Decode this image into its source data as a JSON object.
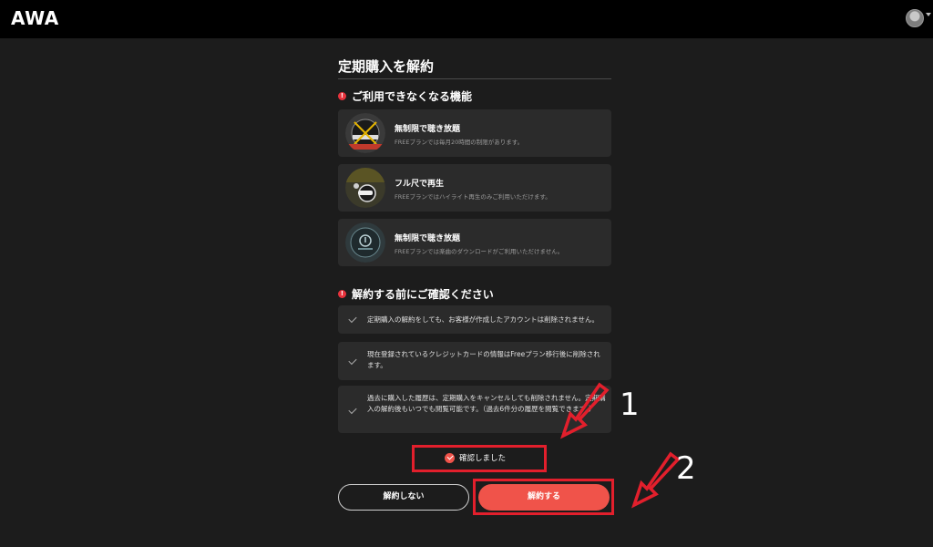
{
  "app": {
    "logo": "AWA"
  },
  "dialog": {
    "title": "定期購入を解約",
    "features_heading": "ご利用できなくなる機能",
    "features": [
      {
        "title": "無制限で聴き放題",
        "description": "FREEプランでは毎月20時間の制限があります。",
        "icon": "unlimited-listening-thumbnail"
      },
      {
        "title": "フル尺で再生",
        "description": "FREEプランではハイライト再生のみご利用いただけます。",
        "icon": "full-length-play-thumbnail"
      },
      {
        "title": "無制限で聴き放題",
        "description": "FREEプランでは楽曲のダウンロードがご利用いただけません。",
        "icon": "download-thumbnail"
      }
    ],
    "confirm_heading": "解約する前にご確認ください",
    "confirmations": [
      "定期購入の解約をしても、お客様が作成したアカウントは削除されません。",
      "現在登録されているクレジットカードの情報はFreeプラン移行後に削除されます。",
      "過去に購入した履歴は、定期購入をキャンセルしても削除されません。定期購入の解約後もいつでも閲覧可能です。（過去6件分の履歴を閲覧できます。）"
    ],
    "checkbox_label": "確認しました",
    "cancel_button": "解約しない",
    "confirm_button": "解約する"
  },
  "annotations": {
    "step1": "1",
    "step2": "2",
    "highlight_color": "#e21f2c"
  },
  "colors": {
    "background": "#1c1c1c",
    "card": "#2b2b2b",
    "accent": "#f0534a",
    "alert": "#e8323c"
  }
}
